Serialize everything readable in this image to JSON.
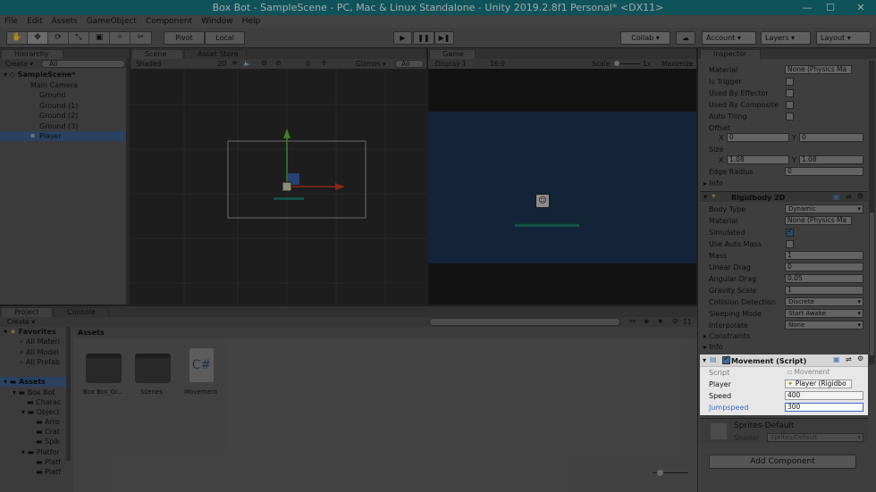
{
  "window": {
    "title": "Box Bot - SampleScene - PC, Mac & Linux Standalone - Unity 2019.2.8f1 Personal* <DX11>",
    "min": "—",
    "max": "☐",
    "close": "✕"
  },
  "menu": [
    "File",
    "Edit",
    "Assets",
    "GameObject",
    "Component",
    "Window",
    "Help"
  ],
  "toolbar": {
    "pivot": "Pivot",
    "local": "Local",
    "collab": "Collab ▾",
    "account": "Account",
    "layers": "Layers",
    "layout": "Layout",
    "play": "▶",
    "pause": "❚❚",
    "step": "▶❚"
  },
  "hierarchy": {
    "tab": "Hierarchy",
    "create": "Create ▾",
    "search": "All",
    "scene": "SampleScene*",
    "items": [
      "Main Camera",
      "Ground",
      "Ground (1)",
      "Ground (2)",
      "Ground (3)",
      "Player"
    ]
  },
  "scene": {
    "tab": "Scene",
    "tab2": "Asset Store",
    "shading": "Shaded",
    "mode2d": "2D",
    "gizmos": "Gizmos ▾",
    "search": "All",
    "hidden_count": "0"
  },
  "game": {
    "tab": "Game",
    "display": "Display 1",
    "aspect": "16:9",
    "scale_label": "Scale",
    "scale_value": "1x",
    "maximize": "Maximize O"
  },
  "project": {
    "tab": "Project",
    "tab2": "Console",
    "create": "Create ▾",
    "favorites": "Favorites",
    "fav_items": [
      "All Materi",
      "All Model",
      "All Prefab"
    ],
    "assets": "Assets",
    "tree": [
      "Box Bot",
      "Charac",
      "Object",
      "Arro",
      "Crat",
      "Spik",
      "Platfor",
      "Platf",
      "Platf"
    ],
    "grid_header": "Assets",
    "grid_items": [
      "Box Bot_Gr...",
      "Scenes",
      "Movement"
    ],
    "csharp": "C#",
    "count": "11"
  },
  "inspector": {
    "tab": "Inspector",
    "collider": [
      {
        "label": "Material",
        "value": "None (Physics Ma"
      },
      {
        "label": "Is Trigger"
      },
      {
        "label": "Used By Effector"
      },
      {
        "label": "Used By Composite"
      },
      {
        "label": "Auto Tiling"
      },
      {
        "label": "Offset"
      },
      {
        "label": "Size"
      },
      {
        "label": "Edge Radius",
        "value": "0"
      },
      {
        "label": "Info"
      }
    ],
    "offset": {
      "x_label": "X",
      "x": "0",
      "y_label": "Y",
      "y": "0"
    },
    "size": {
      "x_label": "X",
      "x": "1.08",
      "y_label": "Y",
      "y": "1.08"
    },
    "rigidbody": {
      "title": "Rigidbody 2D",
      "rows": [
        {
          "label": "Body Type",
          "value": "Dynamic"
        },
        {
          "label": "Material",
          "value": "None (Physics Ma"
        },
        {
          "label": "Simulated"
        },
        {
          "label": "Use Auto Mass"
        },
        {
          "label": "Mass",
          "value": "1"
        },
        {
          "label": "Linear Drag",
          "value": "0"
        },
        {
          "label": "Angular Drag",
          "value": "0.05"
        },
        {
          "label": "Gravity Scale",
          "value": "1"
        },
        {
          "label": "Collision Detection",
          "value": "Discrete"
        },
        {
          "label": "Sleeping Mode",
          "value": "Start Awake"
        },
        {
          "label": "Interpolate",
          "value": "None"
        },
        {
          "label": "Constraints"
        },
        {
          "label": "Info"
        }
      ]
    },
    "movement": {
      "title": "Movement (Script)",
      "rows": [
        {
          "label": "Script",
          "value": "Movement"
        },
        {
          "label": "Player",
          "value": "Player (Rigidbo"
        },
        {
          "label": "Speed",
          "value": "400"
        },
        {
          "label": "Jumpspeed",
          "value": "300"
        }
      ]
    },
    "material": {
      "name": "Sprites-Default",
      "shader_label": "Shader",
      "shader": "Sprites/Default"
    },
    "add_component": "Add Component"
  },
  "colors": {
    "titlebar": "#167680",
    "game_sky": "#1c3351",
    "highlight": "#e7e7e7"
  }
}
